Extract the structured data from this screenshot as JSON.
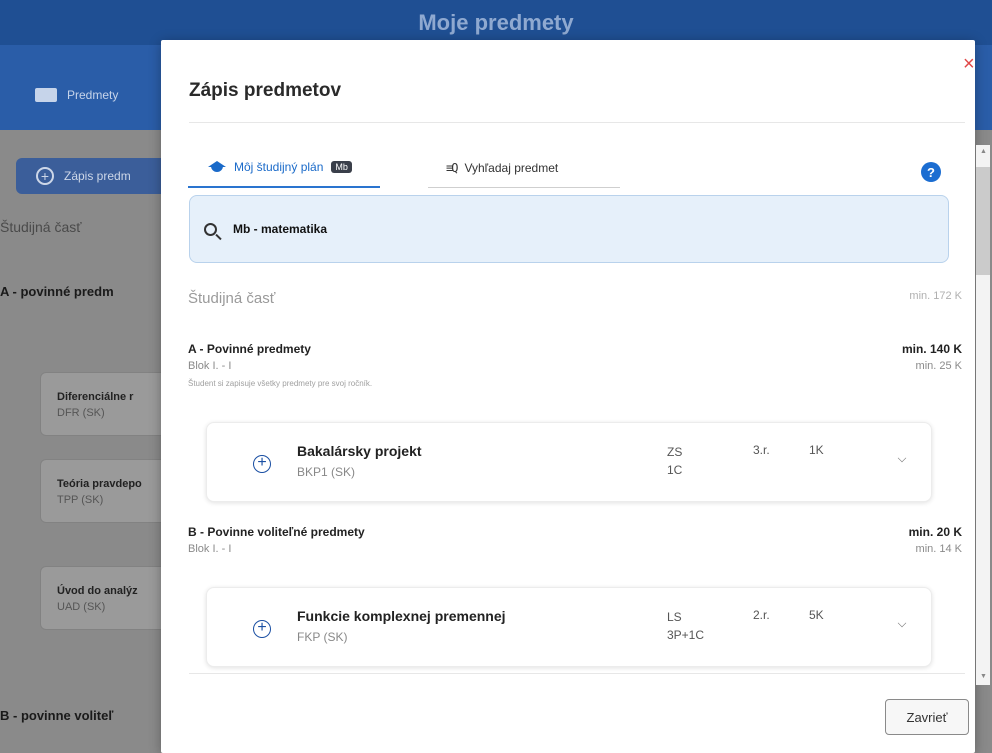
{
  "app": {
    "title": "Moje predmety",
    "nav_item": "Predmety",
    "enroll_button": "Zápis predm",
    "section": "Študijná časť",
    "group_a": "A - povinné predm",
    "group_b": "B - povinne voliteľ",
    "cards": [
      {
        "title": "Diferenciálne r",
        "code": "DFR (SK)"
      },
      {
        "title": "Teória pravdepo",
        "code": "TPP (SK)"
      },
      {
        "title": "Úvod do analýz",
        "code": "UAD (SK)"
      }
    ]
  },
  "modal": {
    "title": "Zápis predmetov",
    "close_symbol": "×",
    "tabs": [
      {
        "label": "Môj študijný plán",
        "badge": "Mb"
      },
      {
        "label": "Vyhľadaj predmet",
        "icon_text": "≡Q"
      }
    ],
    "help_symbol": "?",
    "search": {
      "value": "Mb - matematika"
    },
    "study_part": {
      "label": "Študijná časť",
      "min": "min. 172 K"
    },
    "groups": [
      {
        "name": "A - Povinné predmety",
        "min": "min. 140 K",
        "block": "Blok I. - I",
        "block_min": "min. 25 K",
        "note": "Študent si zapisuje všetky predmety pre svoj ročník.",
        "courses": [
          {
            "name": "Bakalársky projekt",
            "code": "BKP1 (SK)",
            "semester": "ZS",
            "hours": "1C",
            "year": "3.r.",
            "credits": "1K"
          }
        ]
      },
      {
        "name": "B - Povinne voliteľné predmety",
        "min": "min. 20 K",
        "block": "Blok I. - I",
        "block_min": "min. 14 K",
        "courses": [
          {
            "name": "Funkcie komplexnej premennej",
            "code": "FKP (SK)",
            "semester": "LS",
            "hours": "3P+1C",
            "year": "2.r.",
            "credits": "5K"
          }
        ]
      }
    ],
    "close_button": "Zavrieť"
  },
  "icons": {
    "close": "close-icon",
    "cap": "graduation-cap-icon",
    "list_search": "list-search-icon",
    "help": "help-icon",
    "search": "search-icon",
    "add": "add-circle-icon",
    "expand": "chevron-down-icon"
  },
  "colors": {
    "primary": "#1f4f93",
    "accent": "#1a6ac9",
    "close": "#e04848",
    "search_bg": "#e6f0fa"
  }
}
